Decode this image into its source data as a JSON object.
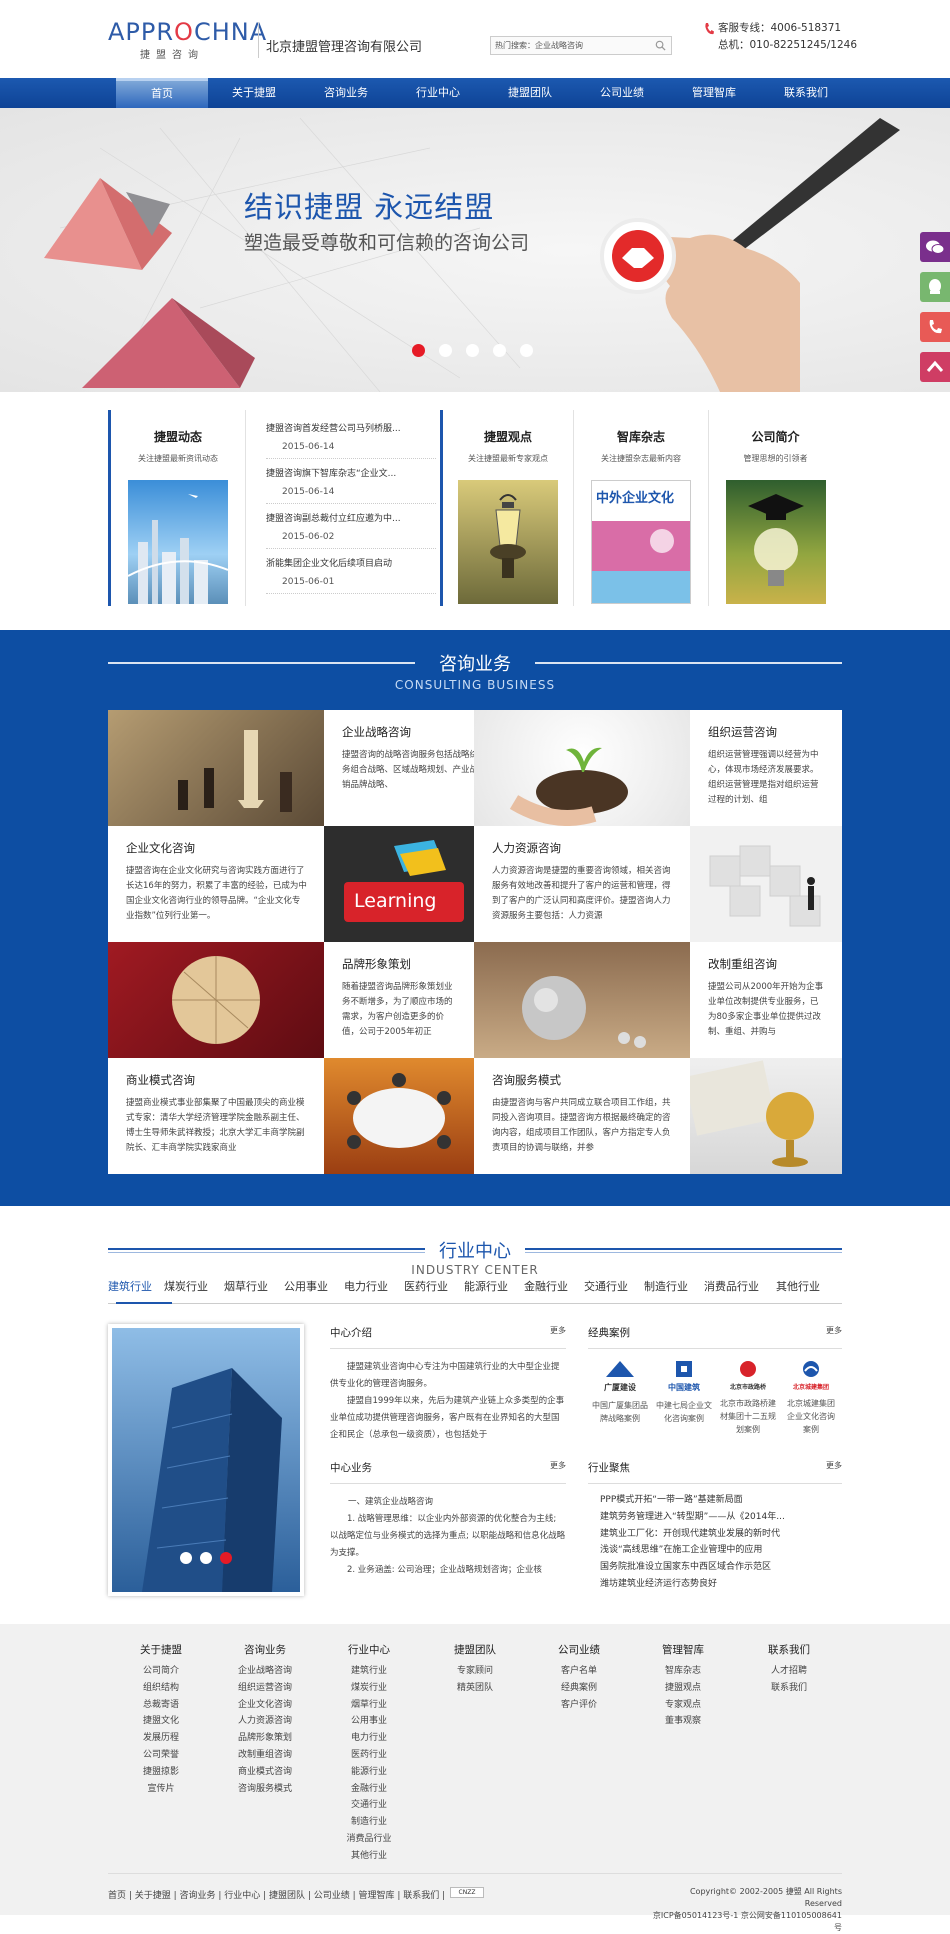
{
  "header": {
    "logo_en_a": "APPR",
    "logo_en_b": "O",
    "logo_en_c": "CHNA",
    "logo_cn": "捷盟咨询",
    "company": "北京捷盟管理咨询有限公司",
    "search_text": "热门搜索：企业战略咨询",
    "hotline": "客服专线：4006-518371",
    "switchboard": "总机：010-82251245/1246"
  },
  "nav": [
    "首页",
    "关于捷盟",
    "咨询业务",
    "行业中心",
    "捷盟团队",
    "公司业绩",
    "管理智库",
    "联系我们"
  ],
  "banner": {
    "title": "结识捷盟  永远结盟",
    "subtitle": "塑造最受尊敬和可信赖的咨询公司",
    "slide_count": 5,
    "active_slide": 1
  },
  "info": {
    "dynamics": {
      "title": "捷盟动态",
      "sub": "关注捷盟最新资讯动态"
    },
    "news": [
      {
        "title": "捷盟咨询首发经营公司马列桥服...",
        "date": "2015-06-14"
      },
      {
        "title": "捷盟咨询旗下智库杂志“企业文...",
        "date": "2015-06-14"
      },
      {
        "title": "捷盟咨询副总裁付立红应邀为中...",
        "date": "2015-06-02"
      },
      {
        "title": "浙能集团企业文化后续项目启动",
        "date": "2015-06-01"
      }
    ],
    "views": {
      "title": "捷盟观点",
      "sub": "关注捷盟最新专家观点"
    },
    "magazine": {
      "title": "智库杂志",
      "sub": "关注捷盟杂志最新内容",
      "cover_text": "中外企业文化"
    },
    "profile": {
      "title": "公司简介",
      "sub": "管理思想的引领者"
    }
  },
  "consult": {
    "title": "咨询业务",
    "subtitle": "CONSULTING BUSINESS",
    "items": [
      {
        "title": "企业战略咨询",
        "text": "捷盟咨询的战略咨询服务包括战略综合规划、业务组合战略、区域战略规划、产业战略规划、营销品牌战略、"
      },
      {
        "title": "组织运营咨询",
        "text": "组织运营管理强调以经营为中心，体现市场经济发展要求。组织运营管理是指对组织运营过程的计划、组"
      },
      {
        "title": "企业文化咨询",
        "text": "捷盟咨询在企业文化研究与咨询实践方面进行了长达16年的努力，积累了丰富的经验，已成为中国企业文化咨询行业的领导品牌。“企业文化专业指数”位列行业第一。"
      },
      {
        "title": "人力资源咨询",
        "text": "人力资源咨询是捷盟的重要咨询领域，相关咨询服务有效地改善和提升了客户的运营和管理，得到了客户的广泛认同和高度评价。捷盟咨询人力资源服务主要包括：人力资源"
      },
      {
        "title": "品牌形象策划",
        "text": "随着捷盟咨询品牌形象策划业务不断增多，为了顺应市场的需求，为客户创造更多的价值，公司于2005年初正"
      },
      {
        "title": "改制重组咨询",
        "text": "捷盟公司从2000年开始为企事业单位改制提供专业服务，已为80多家企事业单位提供过改制、重组、并购与"
      },
      {
        "title": "商业模式咨询",
        "text": "捷盟商业模式事业部集聚了中国最顶尖的商业模式专家：清华大学经济管理学院金融系副主任、博士生导师朱武祥教授；北京大学汇丰商学院副院长、汇丰商学院实践家商业"
      },
      {
        "title": "咨询服务模式",
        "text": "由捷盟咨询与客户共同成立联合项目工作组，共同投入咨询项目。捷盟咨询方根据最终确定的咨询内容，组成项目工作团队，客户方指定专人负责项目的协调与联络，并参"
      }
    ],
    "learning_label": "Learning"
  },
  "industry": {
    "title": "行业中心",
    "subtitle": "INDUSTRY CENTER",
    "tabs": [
      "建筑行业",
      "煤炭行业",
      "烟草行业",
      "公用事业",
      "电力行业",
      "医药行业",
      "能源行业",
      "金融行业",
      "交通行业",
      "制造行业",
      "消费品行业",
      "其他行业"
    ],
    "active_tab": 0,
    "intro_title": "中心介绍",
    "intro_text": "捷盟建筑业咨询中心专注为中国建筑行业的大中型企业提供专业化的管理咨询服务。",
    "intro_text2": "捷盟自1999年以来，先后为建筑产业链上众多类型的企事业单位成功提供管理咨询服务，客户既有在业界知名的大型国企和民企（总承包一级资质），也包括处于",
    "cases_title": "经典案例",
    "cases": [
      {
        "logo": "广厦建设",
        "text": "中国广厦集团品牌战略案例"
      },
      {
        "logo": "中国建筑",
        "text": "中建七局企业文化咨询案例"
      },
      {
        "logo": "北京市政路桥",
        "text": "北京市政路桥建材集团十二五规划案例"
      },
      {
        "logo": "北京城建集团",
        "text": "北京城建集团企业文化咨询案例"
      }
    ],
    "biz_title": "中心业务",
    "biz_lines": [
      "一、建筑企业战略咨询",
      "1. 战略管理思维：以企业内外部资源的优化整合为主线; 以战略定位与业务模式的选择为重点; 以职能战略和信息化战略为支撑。",
      "2. 业务涵盖: 公司治理；企业战略规划咨询；企业核"
    ],
    "focus_title": "行业聚焦",
    "focus": [
      "PPP模式开拓“一带一路”基建新局面",
      "建筑劳务管理进入“转型期”——从《2014年...",
      "建筑业工厂化：开创现代建筑业发展的新时代",
      "浅谈“高线思维”在施工企业管理中的应用",
      "国务院批准设立国家东中西区域合作示范区",
      "潍坊建筑业经济运行态势良好"
    ],
    "more": "更多",
    "photo_dots": 3,
    "photo_active": 3
  },
  "footer": {
    "columns": [
      {
        "title": "关于捷盟",
        "items": [
          "公司简介",
          "组织结构",
          "总裁寄语",
          "捷盟文化",
          "发展历程",
          "公司荣誉",
          "捷盟掠影",
          "宣传片"
        ]
      },
      {
        "title": "咨询业务",
        "items": [
          "企业战略咨询",
          "组织运营咨询",
          "企业文化咨询",
          "人力资源咨询",
          "品牌形象策划",
          "改制重组咨询",
          "商业模式咨询",
          "咨询服务模式"
        ]
      },
      {
        "title": "行业中心",
        "items": [
          "建筑行业",
          "煤炭行业",
          "烟草行业",
          "公用事业",
          "电力行业",
          "医药行业",
          "能源行业",
          "金融行业",
          "交通行业",
          "制造行业",
          "消费品行业",
          "其他行业"
        ]
      },
      {
        "title": "捷盟团队",
        "items": [
          "专家顾问",
          "精英团队"
        ]
      },
      {
        "title": "公司业绩",
        "items": [
          "客户名单",
          "经典案例",
          "客户评价"
        ]
      },
      {
        "title": "管理智库",
        "items": [
          "智库杂志",
          "捷盟观点",
          "专家观点",
          "董事观察"
        ]
      },
      {
        "title": "联系我们",
        "items": [
          "人才招聘",
          "联系我们"
        ]
      }
    ],
    "links": "首页 | 关于捷盟 | 咨询业务 | 行业中心 | 捷盟团队 | 公司业绩 | 管理智库 | 联系我们 |",
    "badge": "CNZZ",
    "copyright": "Copyright© 2002-2005 捷盟 All Rights Reserved",
    "icp": "京ICP备05014123号-1 京公网安备110105008641号"
  },
  "colors": {
    "brand_blue": "#0d4ea3",
    "nav_blue": "#1c59b0",
    "accent_red": "#e61b26"
  }
}
